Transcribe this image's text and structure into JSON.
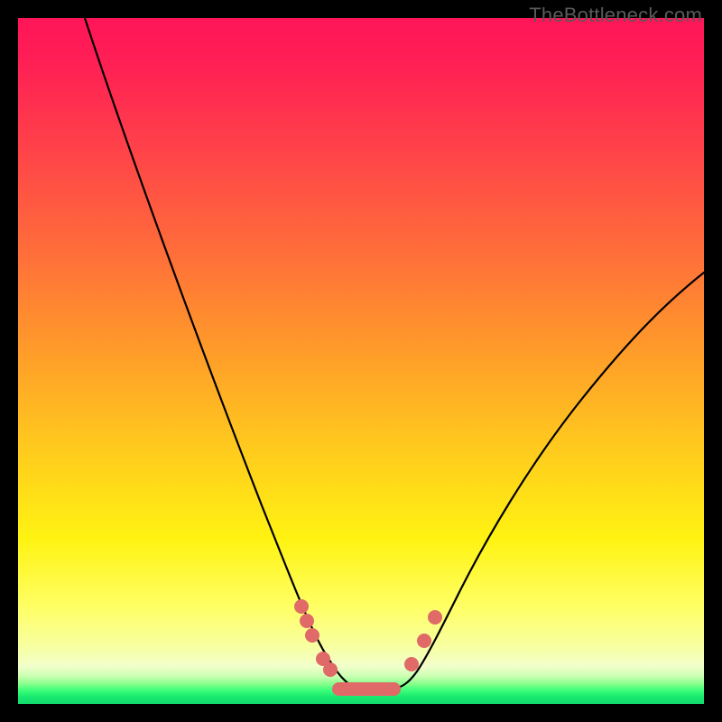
{
  "watermark": "TheBottleneck.com",
  "colors": {
    "frame": "#000000",
    "curve": "#000000",
    "marker": "#e06a67",
    "gradient_top": "#ff1559",
    "gradient_mid": "#ffc81e",
    "gradient_bottom": "#12da6d"
  },
  "chart_data": {
    "type": "line",
    "title": "",
    "xlabel": "",
    "ylabel": "",
    "xlim": [
      0,
      100
    ],
    "ylim": [
      0,
      100
    ],
    "grid": false,
    "legend": false,
    "x": [
      0,
      5,
      10,
      15,
      20,
      25,
      30,
      35,
      40,
      42,
      44,
      46,
      48,
      50,
      52,
      54,
      56,
      58,
      60,
      65,
      70,
      75,
      80,
      85,
      90,
      95,
      100
    ],
    "values": [
      100,
      94,
      86,
      77,
      67,
      56,
      44,
      31,
      17,
      12,
      8,
      5,
      3,
      2.2,
      2,
      2.2,
      3,
      6,
      10,
      19,
      28,
      36,
      43,
      49,
      55,
      59,
      63
    ],
    "annotations": [
      {
        "label": "marker",
        "x": 41.0,
        "y": 14.0
      },
      {
        "label": "marker",
        "x": 42.0,
        "y": 11.5
      },
      {
        "label": "marker",
        "x": 43.0,
        "y": 9.5
      },
      {
        "label": "marker",
        "x": 45.0,
        "y": 6.0
      },
      {
        "label": "marker",
        "x": 46.0,
        "y": 4.8
      },
      {
        "label": "marker",
        "x": 57.5,
        "y": 5.5
      },
      {
        "label": "marker",
        "x": 59.5,
        "y": 9.5
      },
      {
        "label": "marker",
        "x": 61.0,
        "y": 12.5
      },
      {
        "label": "flat-segment",
        "x": 47.0,
        "y": 2.2,
        "x2": 56.0
      }
    ]
  }
}
